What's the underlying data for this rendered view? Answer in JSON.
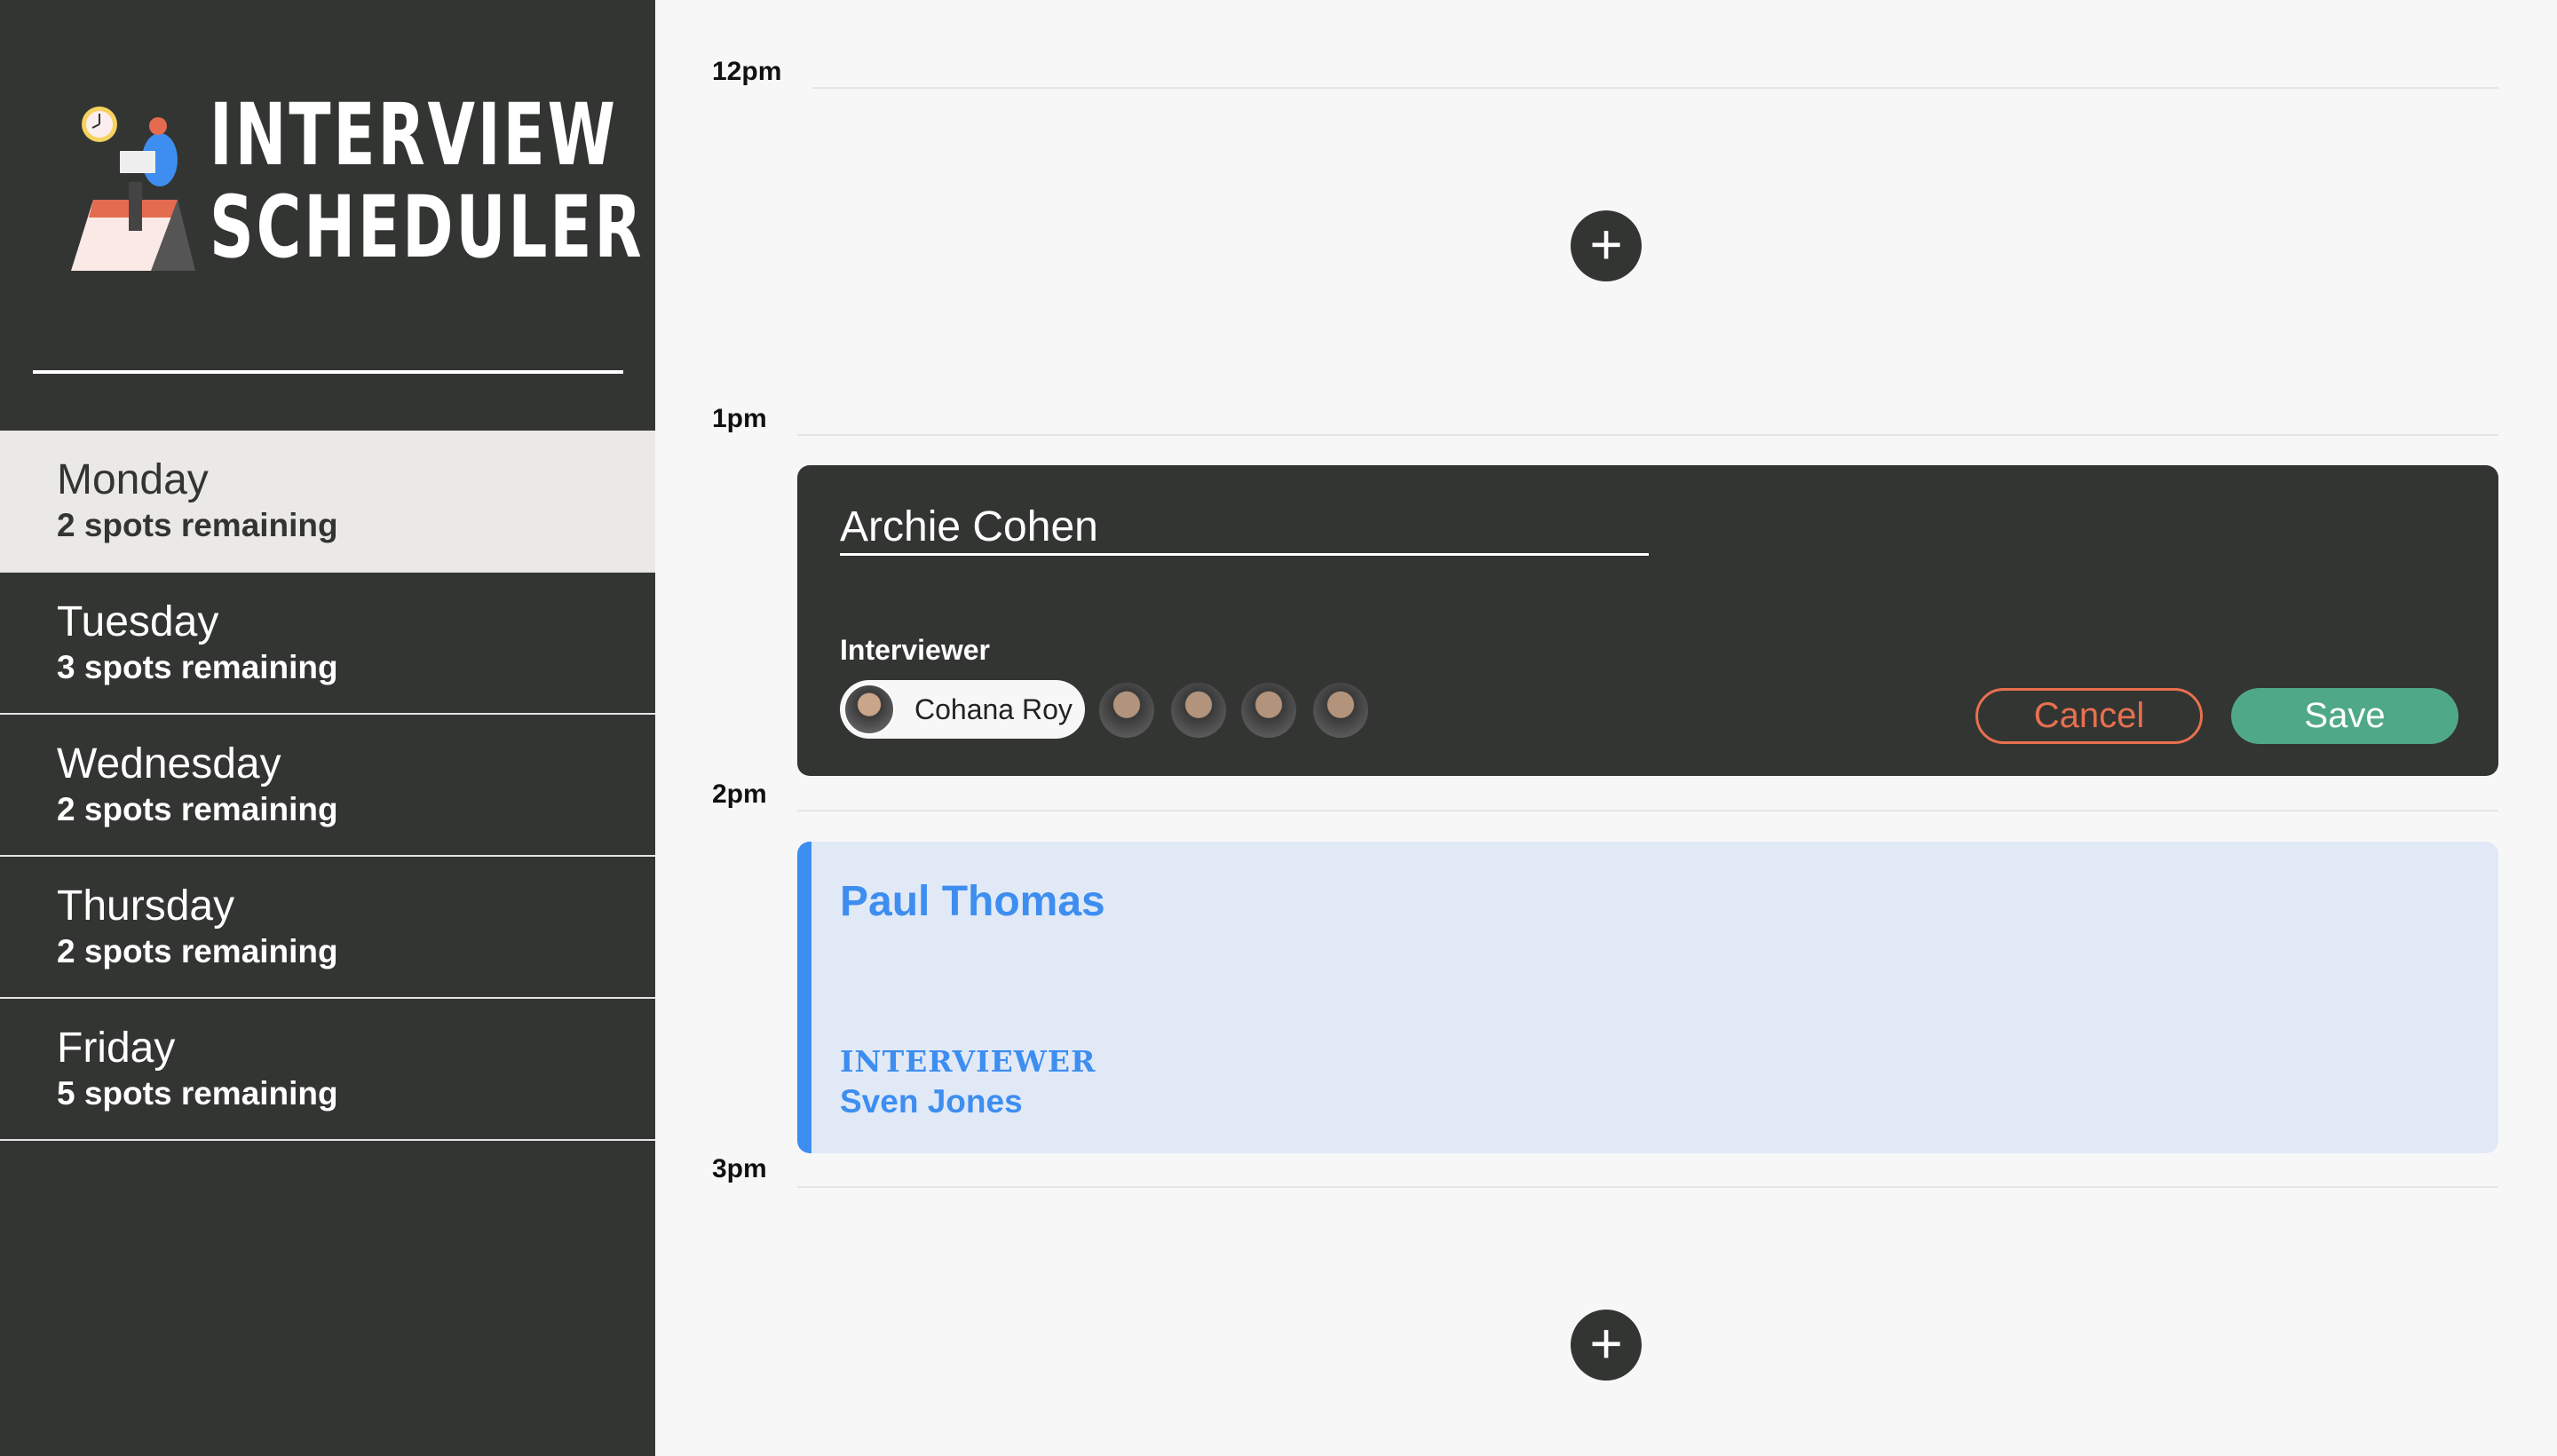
{
  "app": {
    "title_line1": "INTERVIEW",
    "title_line2": "SCHEDULER"
  },
  "sidebar": {
    "days": [
      {
        "day": "Monday",
        "spots": "2 spots remaining",
        "selected": true
      },
      {
        "day": "Tuesday",
        "spots": "3 spots remaining"
      },
      {
        "day": "Wednesday",
        "spots": "2 spots remaining"
      },
      {
        "day": "Thursday",
        "spots": "2 spots remaining"
      },
      {
        "day": "Friday",
        "spots": "5 spots remaining"
      }
    ]
  },
  "schedule": {
    "times": [
      "12pm",
      "1pm",
      "2pm",
      "3pm"
    ],
    "add_icon": "+",
    "edit_form": {
      "student_name": "Archie Cohen",
      "interviewer_label": "Interviewer",
      "selected_interviewer": "Cohana Roy",
      "cancel_label": "Cancel",
      "save_label": "Save"
    },
    "appointment": {
      "student": "Paul Thomas",
      "interviewer_label": "INTERVIEWER",
      "interviewer": "Sven Jones"
    }
  },
  "colors": {
    "sidebar": "#333533",
    "accent_blue": "#3d8ef0",
    "save": "#4fa987",
    "cancel": "#e8704f"
  }
}
